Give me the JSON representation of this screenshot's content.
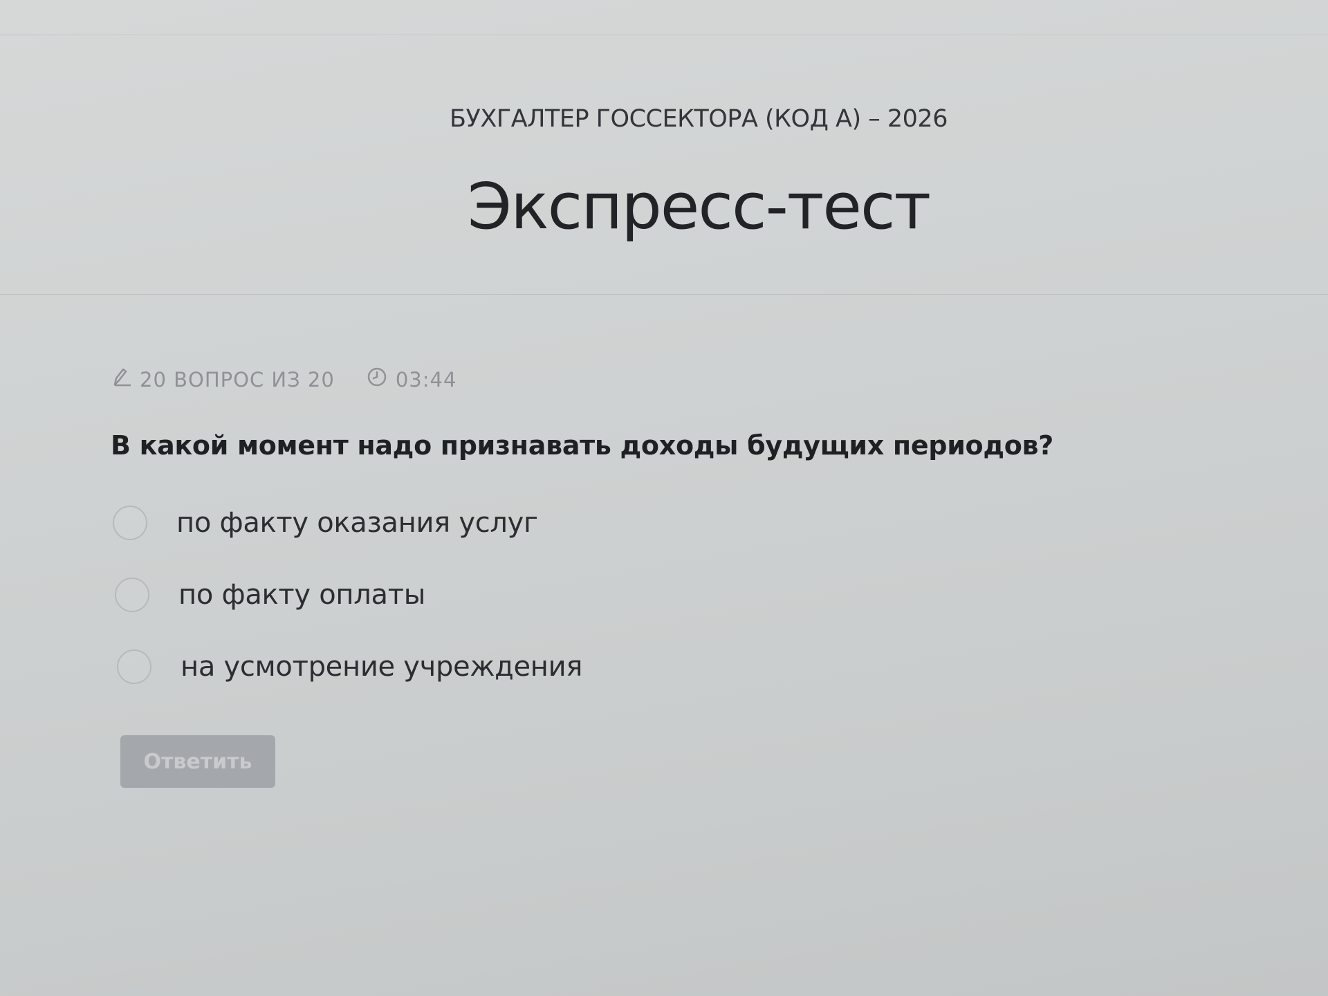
{
  "header": {
    "course_title": "БУХГАЛТЕР ГОССЕКТОРА (КОД А) – 2026",
    "page_title": "Экспресс-тест"
  },
  "meta": {
    "counter_icon": "pencil-icon",
    "counter_text": "20 ВОПРОС ИЗ 20",
    "timer_icon": "clock-icon",
    "timer_text": "03:44"
  },
  "question": {
    "text": "В какой момент надо признавать доходы будущих периодов?",
    "options": [
      {
        "label": "по факту оказания услуг",
        "selected": false
      },
      {
        "label": "по факту оплаты",
        "selected": false
      },
      {
        "label": "на усмотрение учреждения",
        "selected": false
      }
    ]
  },
  "actions": {
    "submit_label": "Ответить",
    "submit_enabled": false
  },
  "colors": {
    "background": "#cfd2d2",
    "text": "#2a2b2e",
    "muted": "#8f9194",
    "button_disabled": "#a4a7ab"
  }
}
